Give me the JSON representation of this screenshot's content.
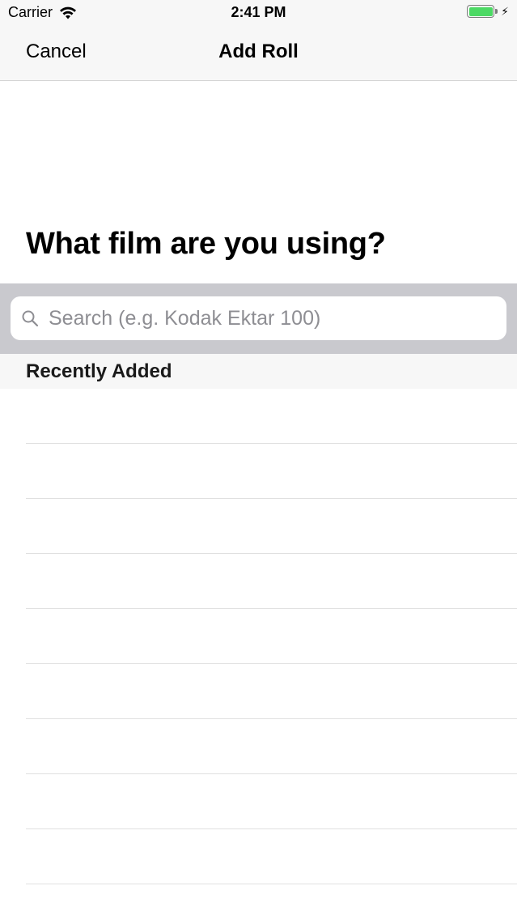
{
  "status_bar": {
    "carrier": "Carrier",
    "time": "2:41 PM",
    "battery_percent": 100,
    "battery_color": "#4cd964",
    "icons": [
      "wifi-icon",
      "battery-icon",
      "charging-bolt-icon"
    ]
  },
  "nav": {
    "cancel_label": "Cancel",
    "title": "Add Roll"
  },
  "question": "What film are you using?",
  "search": {
    "placeholder": "Search (e.g. Kodak Ektar 100)",
    "value": "",
    "icon": "search-icon"
  },
  "section": {
    "title": "Recently Added"
  },
  "list": {
    "row_count": 9
  }
}
